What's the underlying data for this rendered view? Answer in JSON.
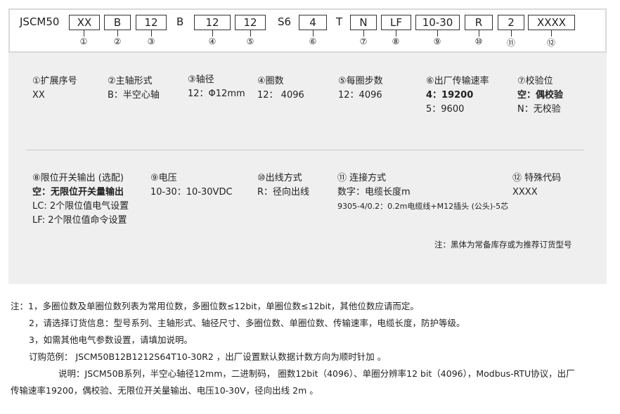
{
  "code": {
    "prefix": "JSCM50",
    "segments": [
      "XX",
      "B",
      "12",
      "B",
      "12",
      "12",
      "S6",
      "4",
      "T",
      "N",
      "LF",
      "10-30",
      "R",
      "2",
      "XXXX"
    ],
    "numbers": [
      "①",
      "②",
      "③",
      "④",
      "⑤",
      "⑥",
      "⑦",
      "⑧",
      "⑨",
      "⑩",
      "⑪",
      "⑫"
    ]
  },
  "row1": [
    {
      "title": "①扩展序号",
      "lines": [
        "XX"
      ]
    },
    {
      "title": "②主轴形式",
      "lines": [
        "B：半空心轴"
      ]
    },
    {
      "title": "③轴径",
      "lines": [
        "12：Φ12mm"
      ]
    },
    {
      "title": "④圈数",
      "lines": [
        "12：  4096"
      ]
    },
    {
      "title": "⑤每圈步数",
      "lines": [
        "12：4096"
      ]
    },
    {
      "title": "⑥出厂传输速率",
      "bold": "4：19200",
      "lines": [
        "5：9600"
      ]
    },
    {
      "title": "⑦校验位",
      "bold": "空：偶校验",
      "lines": [
        "N：无校验"
      ]
    }
  ],
  "row2": [
    {
      "title": "⑧限位开关输出 (选配)",
      "bold": "空：无限位开关量输出",
      "lines": [
        "LC: 2个限位值电气设置",
        "LF: 2个限位值命令设置"
      ]
    },
    {
      "title": "⑨电压",
      "lines": [
        "10-30：10-30VDC"
      ]
    },
    {
      "title": "⑩出线方式",
      "lines": [
        "R：径向出线"
      ]
    },
    {
      "title": "⑪ 连接方式",
      "lines": [
        "数字：电缆长度m"
      ],
      "small": "9305-4/0.2：0.2m电缆线+M12插头 (公头)-5芯"
    },
    {
      "title": "⑫ 特殊代码",
      "lines": [
        "XXXX"
      ]
    }
  ],
  "panel_note": "注：黑体为常备库存或为推荐订货型号",
  "notes": [
    "注：1，多圈位数及单圈位数列表为常用位数，多圈位数≤12bit，单圈位数≤12bit，其他位数应请而定。",
    "2，请选择订货信息：型号系列、主轴形式、轴径尺寸、多圈位数、单圈位数、传输速率，电缆长度，防护等级。",
    "3，如需其他电气参数设置，请填加说明。",
    "订购范例： JSCM50B12B1212S64T10-30R2 ，出厂设置默认数据计数方向为顺时针加 。",
    "说明：JSCM50B系列，半空心轴径12mm，二进制码， 圈数12bit（4096）、单圈分辨率12 bit（4096），Modbus-RTU协议，出厂",
    "传输速率19200，偶校验、无限位开关量输出、电压10-30V，径向出线 2m 。"
  ]
}
